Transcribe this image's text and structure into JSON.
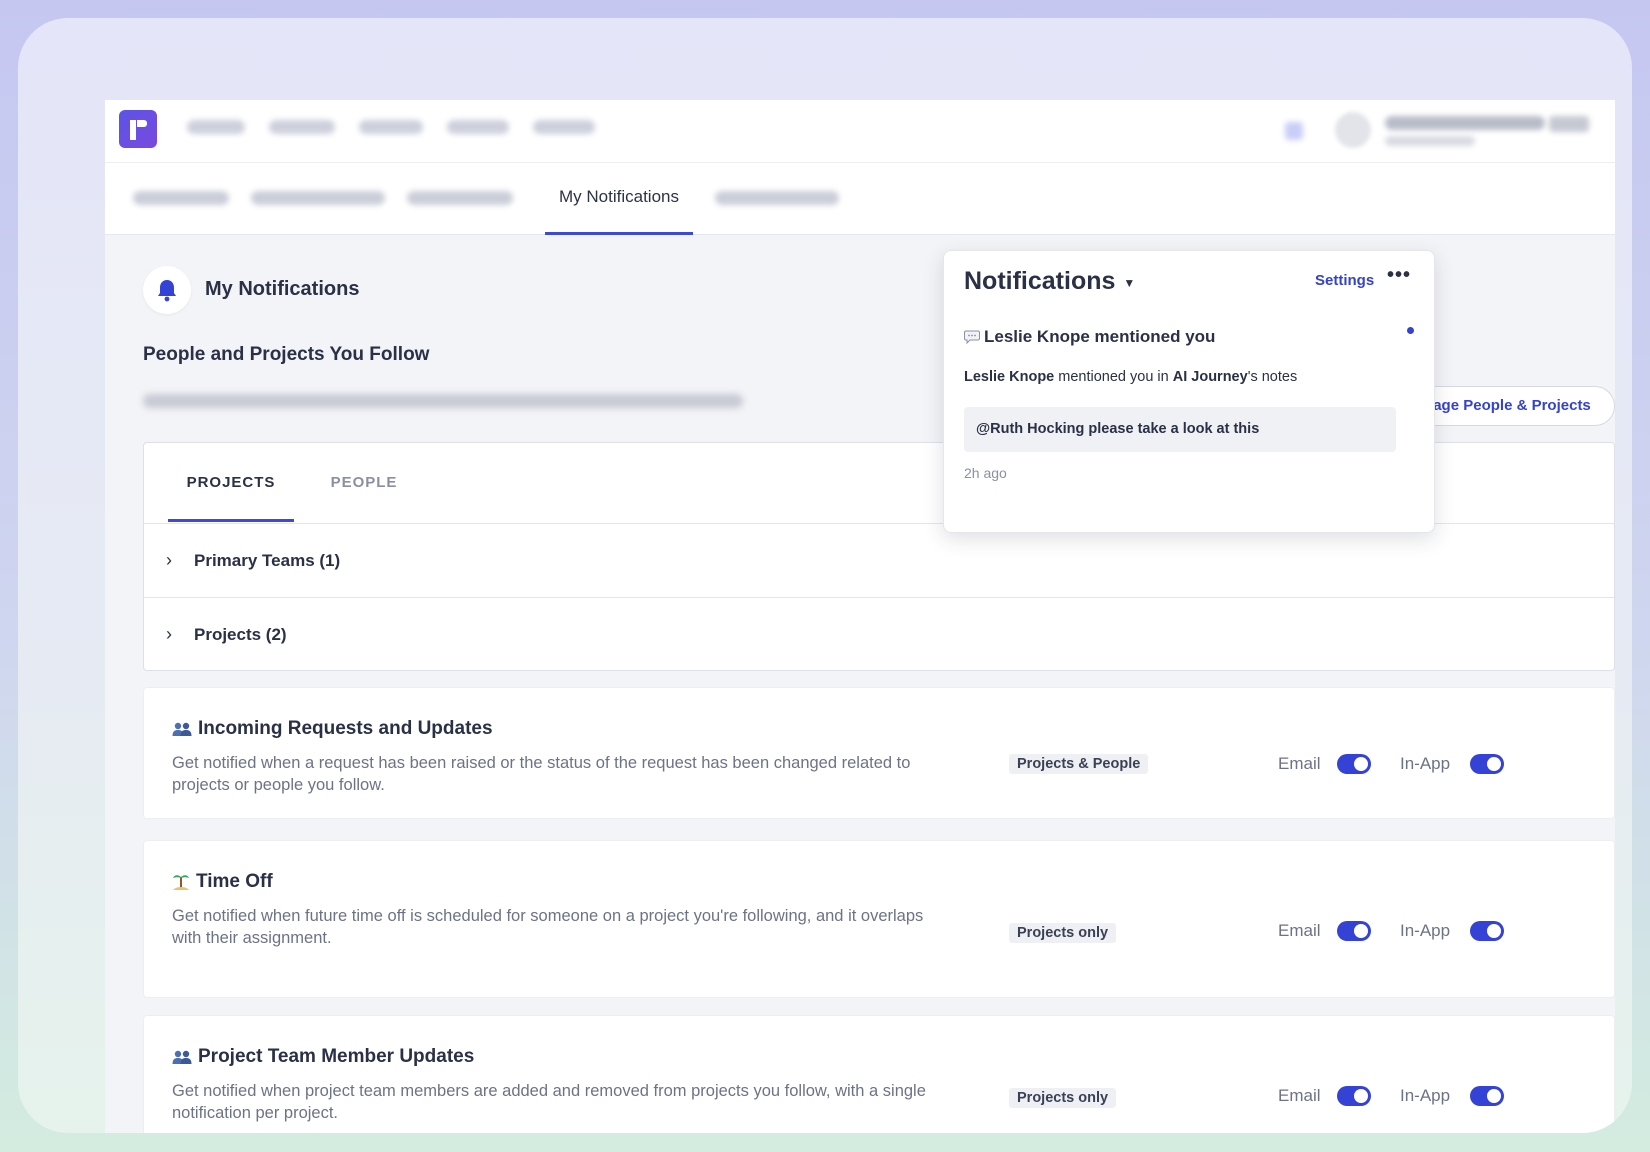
{
  "subnav": {
    "active_tab": "My Notifications"
  },
  "page": {
    "title": "My Notifications",
    "section_title": "People and Projects You Follow",
    "manage_button": "Manage People & Projects"
  },
  "follow": {
    "tabs": [
      "PROJECTS",
      "PEOPLE"
    ],
    "rows": [
      "Primary Teams (1)",
      "Projects (2)"
    ]
  },
  "notif_settings": [
    {
      "title": "Incoming Requests and Updates",
      "description": "Get notified when a request has been raised or the status of the request has been changed related to projects or people you follow.",
      "scope": "Projects & People",
      "email_label": "Email",
      "inapp_label": "In-App",
      "email_on": true,
      "inapp_on": true,
      "icon": "people-icon"
    },
    {
      "title": "Time Off",
      "description": "Get notified when future time off is scheduled for someone on a project you're following, and it overlaps with their assignment.",
      "scope": "Projects only",
      "email_label": "Email",
      "inapp_label": "In-App",
      "email_on": true,
      "inapp_on": true,
      "icon": "island-icon"
    },
    {
      "title": "Project Team Member Updates",
      "description": "Get notified when project team members are added and removed from projects you follow, with a single notification per project.",
      "scope": "Projects only",
      "email_label": "Email",
      "inapp_label": "In-App",
      "email_on": true,
      "inapp_on": true,
      "icon": "people-icon"
    }
  ],
  "popover": {
    "title": "Notifications",
    "settings": "Settings",
    "more": "•••",
    "heading": "Leslie Knope mentioned you",
    "body_author": "Leslie Knope",
    "body_mid": "mentioned you in",
    "body_project": "AI Journey",
    "body_end": "'s notes",
    "quote": "@Ruth Hocking please take a look at this",
    "time": "2h ago"
  },
  "colors": {
    "accent": "#3442cc",
    "toggle_on": "#3443d6",
    "text_dark": "#2a3146",
    "text_muted": "#6c7386"
  }
}
